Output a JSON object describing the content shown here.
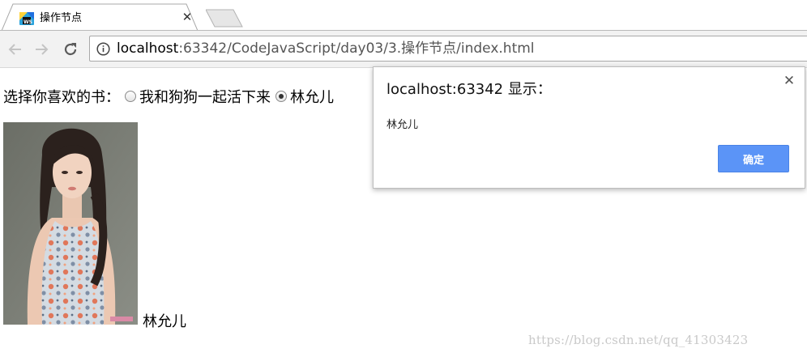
{
  "browser": {
    "tab": {
      "title": "操作节点",
      "favicon": "webstorm-icon",
      "close_glyph": "✕"
    },
    "new_tab": "new-tab-icon",
    "address_bar": {
      "host": "localhost",
      "rest": ":63342/CodeJavaScript/day03/3.操作节点/index.html"
    }
  },
  "page": {
    "prompt": "选择你喜欢的书：",
    "options": [
      {
        "label": "我和狗狗一起活下来",
        "checked": false
      },
      {
        "label": "林允儿",
        "checked": true
      }
    ],
    "image_caption": "林允儿",
    "watermark": "https://blog.csdn.net/qq_41303423"
  },
  "dialog": {
    "title": "localhost:63342 显示：",
    "message": "林允儿",
    "ok_label": "确定",
    "close_glyph": "✕",
    "accent": "#5b94f7"
  }
}
